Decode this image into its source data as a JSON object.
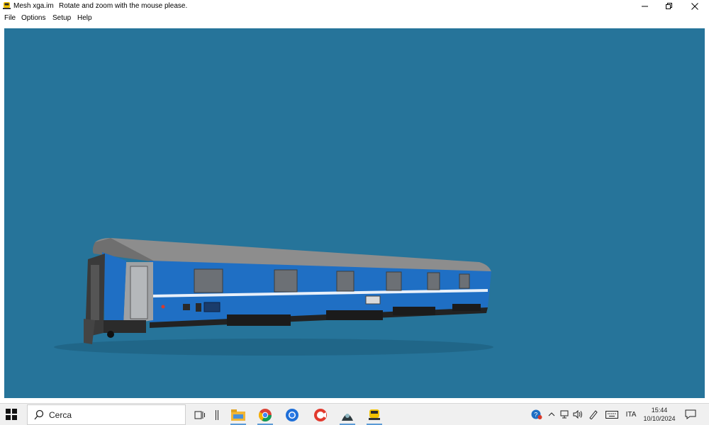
{
  "window": {
    "title": "Mesh xga.im",
    "hint": "Rotate and zoom with the mouse please.",
    "icon": "locomotive-icon"
  },
  "menu": {
    "items": [
      {
        "label": "File"
      },
      {
        "label": "Options"
      },
      {
        "label": "Setup"
      },
      {
        "label": "Help"
      }
    ]
  },
  "viewport": {
    "background": "#26749a",
    "model": "passenger-railcar",
    "car_body_color": "#1f6fc4",
    "car_roof_color": "#8d8d8d",
    "car_stripe_color": "#e8f0fa"
  },
  "taskbar": {
    "search_placeholder": "Cerca",
    "apps": [
      "task-view-icon",
      "divider-icon",
      "file-explorer-icon",
      "chrome-icon",
      "firefox-icon",
      "ccleaner-icon",
      "app-dark-icon",
      "mesh-viewer-icon"
    ],
    "tray": {
      "language": "ITA",
      "time": "15:44",
      "date": "10/10/2024"
    }
  }
}
